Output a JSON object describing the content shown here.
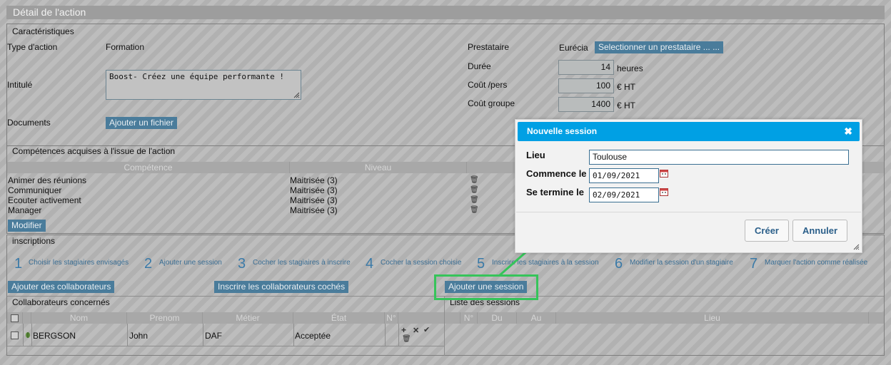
{
  "main_title": "Détail de l'action",
  "caract": {
    "title": "Caractéristiques",
    "type_label": "Type d'action",
    "type_value": "Formation",
    "intitule_label": "Intitulé",
    "intitule_value": "Boost- Créez une équipe performante !",
    "documents_label": "Documents",
    "add_file_btn": "Ajouter un fichier",
    "prestataire_label": "Prestataire",
    "prestataire_value": "Eurécia",
    "select_prestataire_btn": "Selectionner un prestataire ... ...",
    "duree_label": "Durée",
    "duree_value": "14",
    "duree_unit": "heures",
    "cout_pers_label": "Coût /pers",
    "cout_pers_value": "100",
    "cout_pers_unit": "€ HT",
    "cout_groupe_label": "Coût groupe",
    "cout_groupe_value": "1400",
    "cout_groupe_unit": "€ HT"
  },
  "competences": {
    "title": "Compétences acquises à  l'issue de l'action",
    "col_competence": "Compétence",
    "col_niveau": "Niveau",
    "rows": [
      {
        "name": "Animer des réunions",
        "level": "Maitrisée (3)"
      },
      {
        "name": "Communiquer",
        "level": "Maitrisée (3)"
      },
      {
        "name": "Ecouter activement",
        "level": "Maitrisée (3)"
      },
      {
        "name": "Manager",
        "level": "Maitrisée (3)"
      }
    ],
    "modify_btn": "Modifier"
  },
  "inscriptions": {
    "title": "inscriptions",
    "steps": [
      {
        "num": "1",
        "label": "Choisir les stagiaires envisagés"
      },
      {
        "num": "2",
        "label": "Ajouter une session"
      },
      {
        "num": "3",
        "label": "Cocher les stagiaires à inscrire"
      },
      {
        "num": "4",
        "label": "Cocher la session choisie"
      },
      {
        "num": "5",
        "label": "Inscrire les stagiaires à la session"
      },
      {
        "num": "6",
        "label": "Modifier la session d'un stagiaire"
      },
      {
        "num": "7",
        "label": "Marquer l'action comme réalisée"
      }
    ],
    "add_collab_btn": "Ajouter des collaborateurs",
    "inscrire_btn": "Inscrire les collaborateurs cochés",
    "add_session_btn": "Ajouter une session"
  },
  "collaborateurs": {
    "title": "Collaborateurs concernés",
    "col_nom": "Nom",
    "col_prenom": "Prenom",
    "col_metier": "Métier",
    "col_etat": "État",
    "col_num": "N°",
    "row": {
      "nom": "BERGSON",
      "prenom": "John",
      "metier": "DAF",
      "etat": "Acceptée"
    }
  },
  "sessions": {
    "title": "Liste des sessions",
    "col_num": "N°",
    "col_du": "Du",
    "col_au": "Au",
    "col_lieu": "Lieu"
  },
  "modal": {
    "title": "Nouvelle session",
    "lieu_label": "Lieu",
    "lieu_value": "Toulouse",
    "start_label": "Commence le",
    "start_value": "01/09/2021",
    "end_label": "Se termine le",
    "end_value": "02/09/2021",
    "create_btn": "Créer",
    "cancel_btn": "Annuler"
  },
  "colors": {
    "modal_header": "#00a0e4",
    "highlight": "#36c45a",
    "button_bg": "#4a7c9b"
  }
}
